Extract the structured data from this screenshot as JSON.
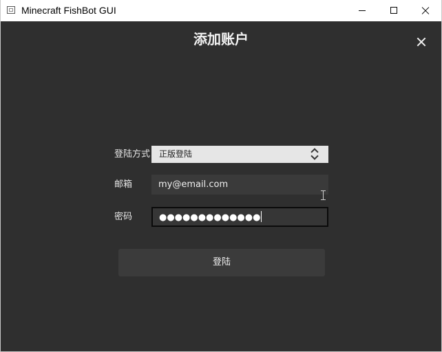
{
  "window": {
    "title": "Minecraft FishBot GUI"
  },
  "dialog": {
    "title": "添加账户",
    "close_icon": "close-icon"
  },
  "form": {
    "method_label": "登陆方式",
    "method_value": "正版登陆",
    "email_label": "邮箱",
    "email_value": "my@email.com",
    "password_label": "密码",
    "password_masked": "●●●●●●●●●●●●●"
  },
  "actions": {
    "login_label": "登陆"
  }
}
